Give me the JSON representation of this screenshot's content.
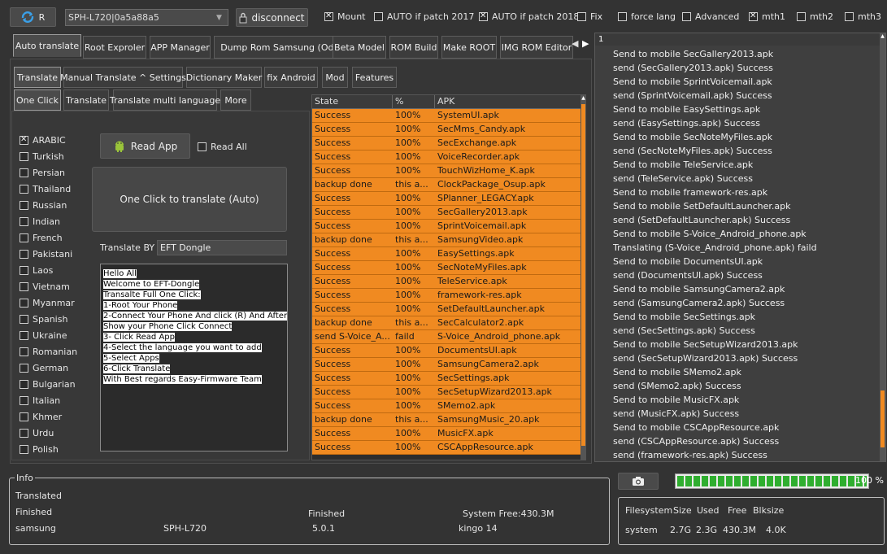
{
  "toolbar": {
    "reboot_label": "R",
    "device_value": "SPH-L720|0a5a88a5",
    "disconnect_label": "disconnect",
    "options": [
      {
        "label": "Mount",
        "checked": true
      },
      {
        "label": "AUTO if patch 2017",
        "checked": false
      },
      {
        "label": "AUTO if patch 2018",
        "checked": true
      },
      {
        "label": "Fix",
        "checked": false
      },
      {
        "label": "force lang",
        "checked": false
      },
      {
        "label": "Advanced",
        "checked": false
      },
      {
        "label": "mth1",
        "checked": true
      },
      {
        "label": "mth2",
        "checked": false
      },
      {
        "label": "mth3",
        "checked": false
      }
    ]
  },
  "main_tabs": [
    "Auto translate",
    "Root Exproler",
    "APP Manager",
    "Dump Rom Samsung (Odin)",
    "Beta Model",
    "ROM Build",
    "Make ROOT",
    "IMG ROM Editor"
  ],
  "sub_tabs": [
    "Translate",
    "Manual Translate ^ Settings",
    "Dictionary Maker",
    "fix Android",
    "Mod",
    "Features"
  ],
  "sub_tabs2": [
    "One Click",
    "Translate",
    "Translate multi language",
    "More"
  ],
  "languages": [
    {
      "label": "ARABIC",
      "checked": true
    },
    {
      "label": "Turkish",
      "checked": false
    },
    {
      "label": "Persian",
      "checked": false
    },
    {
      "label": "Thailand",
      "checked": false
    },
    {
      "label": "Russian",
      "checked": false
    },
    {
      "label": "Indian",
      "checked": false
    },
    {
      "label": "French",
      "checked": false
    },
    {
      "label": "Pakistani",
      "checked": false
    },
    {
      "label": "Laos",
      "checked": false
    },
    {
      "label": "Vietnam",
      "checked": false
    },
    {
      "label": "Myanmar",
      "checked": false
    },
    {
      "label": "Spanish",
      "checked": false
    },
    {
      "label": "Ukraine",
      "checked": false
    },
    {
      "label": "Romanian",
      "checked": false
    },
    {
      "label": "German",
      "checked": false
    },
    {
      "label": "Bulgarian",
      "checked": false
    },
    {
      "label": "Italian",
      "checked": false
    },
    {
      "label": "Khmer",
      "checked": false
    },
    {
      "label": "Urdu",
      "checked": false
    },
    {
      "label": "Polish",
      "checked": false
    }
  ],
  "controls": {
    "read_app_label": "Read App",
    "read_all_label": "Read All",
    "one_click_label": "One Click to translate (Auto)",
    "translate_by_label": "Translate BY",
    "translate_by_value": "EFT Dongle",
    "instructions": [
      "Hello All",
      "Welcome to EFT-Dongle",
      "Transalte Full One Click:",
      "1-Root Your Phone",
      "2-Connect Your Phone And click (R) And After",
      "Show your Phone Click Connect",
      "3- Click Read App",
      "4-Select the language you want to add",
      "5-Select Apps",
      "6-Click Translate",
      "With Best regards Easy-Firmware Team"
    ]
  },
  "table": {
    "headers": [
      "State",
      "%",
      "APK"
    ],
    "rows": [
      [
        "Success",
        "100%",
        "SystemUI.apk"
      ],
      [
        "Success",
        "100%",
        "SecMms_Candy.apk"
      ],
      [
        "Success",
        "100%",
        "SecExchange.apk"
      ],
      [
        "Success",
        "100%",
        "VoiceRecorder.apk"
      ],
      [
        "Success",
        "100%",
        "TouchWizHome_K.apk"
      ],
      [
        "backup done",
        "this a...",
        "ClockPackage_Osup.apk"
      ],
      [
        "Success",
        "100%",
        "SPlanner_LEGACY.apk"
      ],
      [
        "Success",
        "100%",
        "SecGallery2013.apk"
      ],
      [
        "Success",
        "100%",
        "SprintVoicemail.apk"
      ],
      [
        "backup done",
        "this a...",
        "SamsungVideo.apk"
      ],
      [
        "Success",
        "100%",
        "EasySettings.apk"
      ],
      [
        "Success",
        "100%",
        "SecNoteMyFiles.apk"
      ],
      [
        "Success",
        "100%",
        "TeleService.apk"
      ],
      [
        "Success",
        "100%",
        "framework-res.apk"
      ],
      [
        "Success",
        "100%",
        "SetDefaultLauncher.apk"
      ],
      [
        "backup done",
        "this a...",
        "SecCalculator2.apk"
      ],
      [
        "send S-Voice_A...",
        "faild",
        "S-Voice_Android_phone.apk"
      ],
      [
        "Success",
        "100%",
        "DocumentsUI.apk"
      ],
      [
        "Success",
        "100%",
        "SamsungCamera2.apk"
      ],
      [
        "Success",
        "100%",
        "SecSettings.apk"
      ],
      [
        "Success",
        "100%",
        "SecSetupWizard2013.apk"
      ],
      [
        "Success",
        "100%",
        "SMemo2.apk"
      ],
      [
        "backup done",
        "this a...",
        "SamsungMusic_20.apk"
      ],
      [
        "Success",
        "100%",
        "MusicFX.apk"
      ],
      [
        "Success",
        "100%",
        "CSCAppResource.apk"
      ]
    ]
  },
  "log": {
    "header": "1",
    "lines": [
      "Send to mobile SecGallery2013.apk",
      "send  (SecGallery2013.apk) Success",
      "Send to mobile SprintVoicemail.apk",
      "send  (SprintVoicemail.apk) Success",
      "Send to mobile EasySettings.apk",
      "send  (EasySettings.apk) Success",
      "Send to mobile SecNoteMyFiles.apk",
      "send  (SecNoteMyFiles.apk) Success",
      "Send to mobile TeleService.apk",
      "send  (TeleService.apk) Success",
      "Send to mobile framework-res.apk",
      "Send to mobile SetDefaultLauncher.apk",
      "send  (SetDefaultLauncher.apk) Success",
      "Send to mobile S-Voice_Android_phone.apk",
      "Translating (S-Voice_Android_phone.apk) faild",
      "Send to mobile DocumentsUI.apk",
      "send  (DocumentsUI.apk) Success",
      "Send to mobile SamsungCamera2.apk",
      "send  (SamsungCamera2.apk) Success",
      "Send to mobile SecSettings.apk",
      "send  (SecSettings.apk) Success",
      "Send to mobile SecSetupWizard2013.apk",
      "send  (SecSetupWizard2013.apk) Success",
      "Send to mobile SMemo2.apk",
      "send  (SMemo2.apk) Success",
      "Send to mobile MusicFX.apk",
      "send  (MusicFX.apk) Success",
      "Send to mobile CSCAppResource.apk",
      "send  (CSCAppResource.apk) Success",
      "send  (framework-res.apk) Success"
    ]
  },
  "info": {
    "title": "Info",
    "status1": "Translated",
    "status2": "Finished",
    "status3": "Finished",
    "system_free": "System Free:430.3M",
    "manufacturer": "samsung",
    "model": "SPH-L720",
    "android_version": "5.0.1",
    "root_tool": "kingo 14"
  },
  "progress": {
    "value_percent": 100,
    "label": "100 %"
  },
  "filesystem": {
    "headers": [
      "Filesystem",
      "Size",
      "Used",
      "Free",
      "Blksize"
    ],
    "row": [
      "system",
      "2.7G",
      "2.3G",
      "430.3M",
      "4.0K"
    ]
  },
  "colors": {
    "accent_row": "#f08a21",
    "progress_green": "#2fae2f",
    "background": "#333333"
  }
}
